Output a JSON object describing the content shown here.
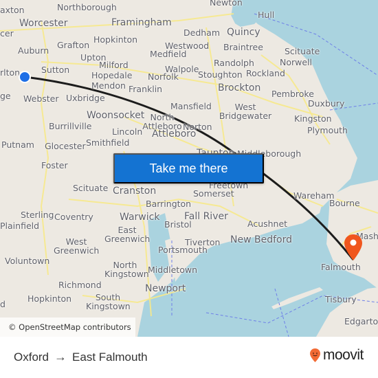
{
  "map": {
    "attribution": "© OpenStreetMap contributors",
    "colors": {
      "water": "#aad3df",
      "land": "#ede9e2",
      "road": "#f7e98a",
      "route": "#1c1c1c",
      "origin": "#1e6fe6",
      "destination": "#f0561d"
    },
    "places": [
      {
        "name": "Northborough",
        "size": "md"
      },
      {
        "name": "Newton",
        "size": "md"
      },
      {
        "name": "Hull",
        "size": "md"
      },
      {
        "name": "axton",
        "size": "md"
      },
      {
        "name": "Worcester",
        "size": "lg"
      },
      {
        "name": "Framingham",
        "size": "lg"
      },
      {
        "name": "Dedham",
        "size": "md"
      },
      {
        "name": "Quincy",
        "size": "lg"
      },
      {
        "name": "cer",
        "size": "md"
      },
      {
        "name": "Grafton",
        "size": "md"
      },
      {
        "name": "Hopkinton",
        "size": "md"
      },
      {
        "name": "Westwood",
        "size": "md"
      },
      {
        "name": "Braintree",
        "size": "md"
      },
      {
        "name": "Scituate",
        "size": "md"
      },
      {
        "name": "Auburn",
        "size": "md"
      },
      {
        "name": "Upton",
        "size": "md"
      },
      {
        "name": "Medfield",
        "size": "md"
      },
      {
        "name": "Randolph",
        "size": "md"
      },
      {
        "name": "Norwell",
        "size": "md"
      },
      {
        "name": "Milford",
        "size": "md"
      },
      {
        "name": "Walpole",
        "size": "md"
      },
      {
        "name": "rlton",
        "size": "md"
      },
      {
        "name": "Sutton",
        "size": "md"
      },
      {
        "name": "Hopedale",
        "size": "md"
      },
      {
        "name": "Norfolk",
        "size": "md"
      },
      {
        "name": "Stoughton",
        "size": "md"
      },
      {
        "name": "Rockland",
        "size": "md"
      },
      {
        "name": "Mendon",
        "size": "md"
      },
      {
        "name": "Franklin",
        "size": "md"
      },
      {
        "name": "Brockton",
        "size": "lg"
      },
      {
        "name": "Pembroke",
        "size": "md"
      },
      {
        "name": "ge",
        "size": "md"
      },
      {
        "name": "Webster",
        "size": "md"
      },
      {
        "name": "Uxbridge",
        "size": "md"
      },
      {
        "name": "Mansfield",
        "size": "md"
      },
      {
        "name": "West Bridgewater",
        "size": "md"
      },
      {
        "name": "Duxbury",
        "size": "md"
      },
      {
        "name": "Woonsocket",
        "size": "lg"
      },
      {
        "name": "North Attleboro",
        "size": "md"
      },
      {
        "name": "Norton",
        "size": "md"
      },
      {
        "name": "Kingston",
        "size": "md"
      },
      {
        "name": "Burrillville",
        "size": "md"
      },
      {
        "name": "Lincoln",
        "size": "md"
      },
      {
        "name": "Attleboro",
        "size": "lg"
      },
      {
        "name": "Plymouth",
        "size": "md"
      },
      {
        "name": "Putnam",
        "size": "md"
      },
      {
        "name": "Glocester",
        "size": "md"
      },
      {
        "name": "Smithfield",
        "size": "md"
      },
      {
        "name": "Taunton",
        "size": "lg"
      },
      {
        "name": "Middleborough",
        "size": "md"
      },
      {
        "name": "Foster",
        "size": "md"
      },
      {
        "name": "Scituate",
        "size": "md"
      },
      {
        "name": "Cranston",
        "size": "lg"
      },
      {
        "name": "Freetown",
        "size": "md"
      },
      {
        "name": "Somerset",
        "size": "md"
      },
      {
        "name": "Wareham",
        "size": "md"
      },
      {
        "name": "Bourne",
        "size": "md"
      },
      {
        "name": "Barrington",
        "size": "md"
      },
      {
        "name": "Sterling",
        "size": "md"
      },
      {
        "name": "Coventry",
        "size": "md"
      },
      {
        "name": "Warwick",
        "size": "lg"
      },
      {
        "name": "Fall River",
        "size": "lg"
      },
      {
        "name": "Bristol",
        "size": "md"
      },
      {
        "name": "Acushnet",
        "size": "md"
      },
      {
        "name": "Mashpee",
        "size": "md"
      },
      {
        "name": "Plainfield",
        "size": "md"
      },
      {
        "name": "East Greenwich",
        "size": "md"
      },
      {
        "name": "New Bedford",
        "size": "lg"
      },
      {
        "name": "West Greenwich",
        "size": "md"
      },
      {
        "name": "Tiverton",
        "size": "md"
      },
      {
        "name": "Portsmouth",
        "size": "md"
      },
      {
        "name": "Voluntown",
        "size": "md"
      },
      {
        "name": "North Kingstown",
        "size": "md"
      },
      {
        "name": "Middletown",
        "size": "md"
      },
      {
        "name": "Falmouth",
        "size": "md"
      },
      {
        "name": "Richmond",
        "size": "md"
      },
      {
        "name": "Newport",
        "size": "lg"
      },
      {
        "name": "Hopkinton",
        "size": "md"
      },
      {
        "name": "South Kingstown",
        "size": "md"
      },
      {
        "name": "Tisbury",
        "size": "md"
      },
      {
        "name": "Edgartown",
        "size": "md"
      },
      {
        "name": "d",
        "size": "md"
      }
    ]
  },
  "cta": {
    "label": "Take me there"
  },
  "route": {
    "origin": "Oxford",
    "destination": "East Falmouth",
    "arrow_icon": "→"
  },
  "brand": {
    "name": "moovit"
  }
}
